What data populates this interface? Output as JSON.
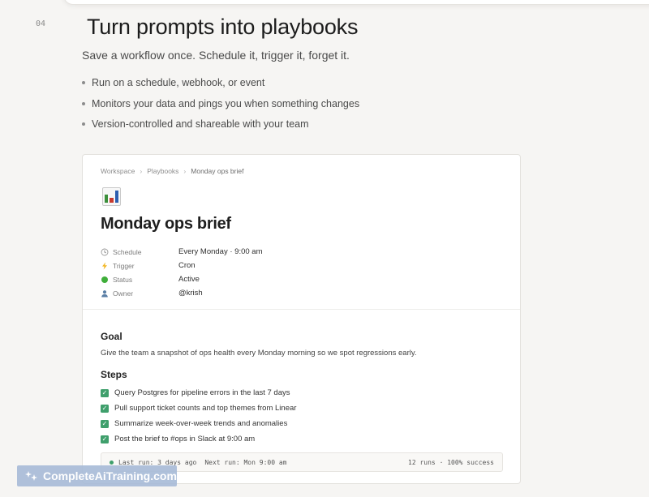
{
  "section_number": "04",
  "hero": {
    "title": "Turn prompts into playbooks",
    "subtitle": "Save a workflow once. Schedule it, trigger it, forget it.",
    "bullets": [
      "Run on a schedule, webhook, or event",
      "Monitors your data and pings you when something changes",
      "Version-controlled and shareable with your team"
    ]
  },
  "doc": {
    "breadcrumb": [
      "Workspace",
      "Playbooks",
      "Monday ops brief"
    ],
    "page_icon": "bar-chart-emoji",
    "title": "Monday ops brief",
    "properties": [
      {
        "icon": "clock-icon",
        "label": "Schedule",
        "value": "Every Monday · 9:00 am"
      },
      {
        "icon": "lightning-icon",
        "label": "Trigger",
        "value": "Cron"
      },
      {
        "icon": "status-dot-icon",
        "label": "Status",
        "value": "Active"
      },
      {
        "icon": "person-icon",
        "label": "Owner",
        "value": "@krish"
      }
    ],
    "goal_heading": "Goal",
    "goal_text": "Give the team a snapshot of ops health every Monday morning so we spot regressions early.",
    "steps_heading": "Steps",
    "steps": [
      "Query Postgres for pipeline errors in the last 7 days",
      "Pull support ticket counts and top themes from Linear",
      "Summarize week-over-week trends and anomalies",
      "Post the brief to #ops in Slack at 9:00 am"
    ],
    "run_status": {
      "last_run": "Last run: 3 days ago",
      "next_run": "Next run: Mon 9:00 am",
      "summary": "12 runs · 100% success"
    }
  },
  "watermark": "CompleteAiTraining.com",
  "colors": {
    "accent_green": "#3f9f6c",
    "background": "#f6f5f3"
  }
}
